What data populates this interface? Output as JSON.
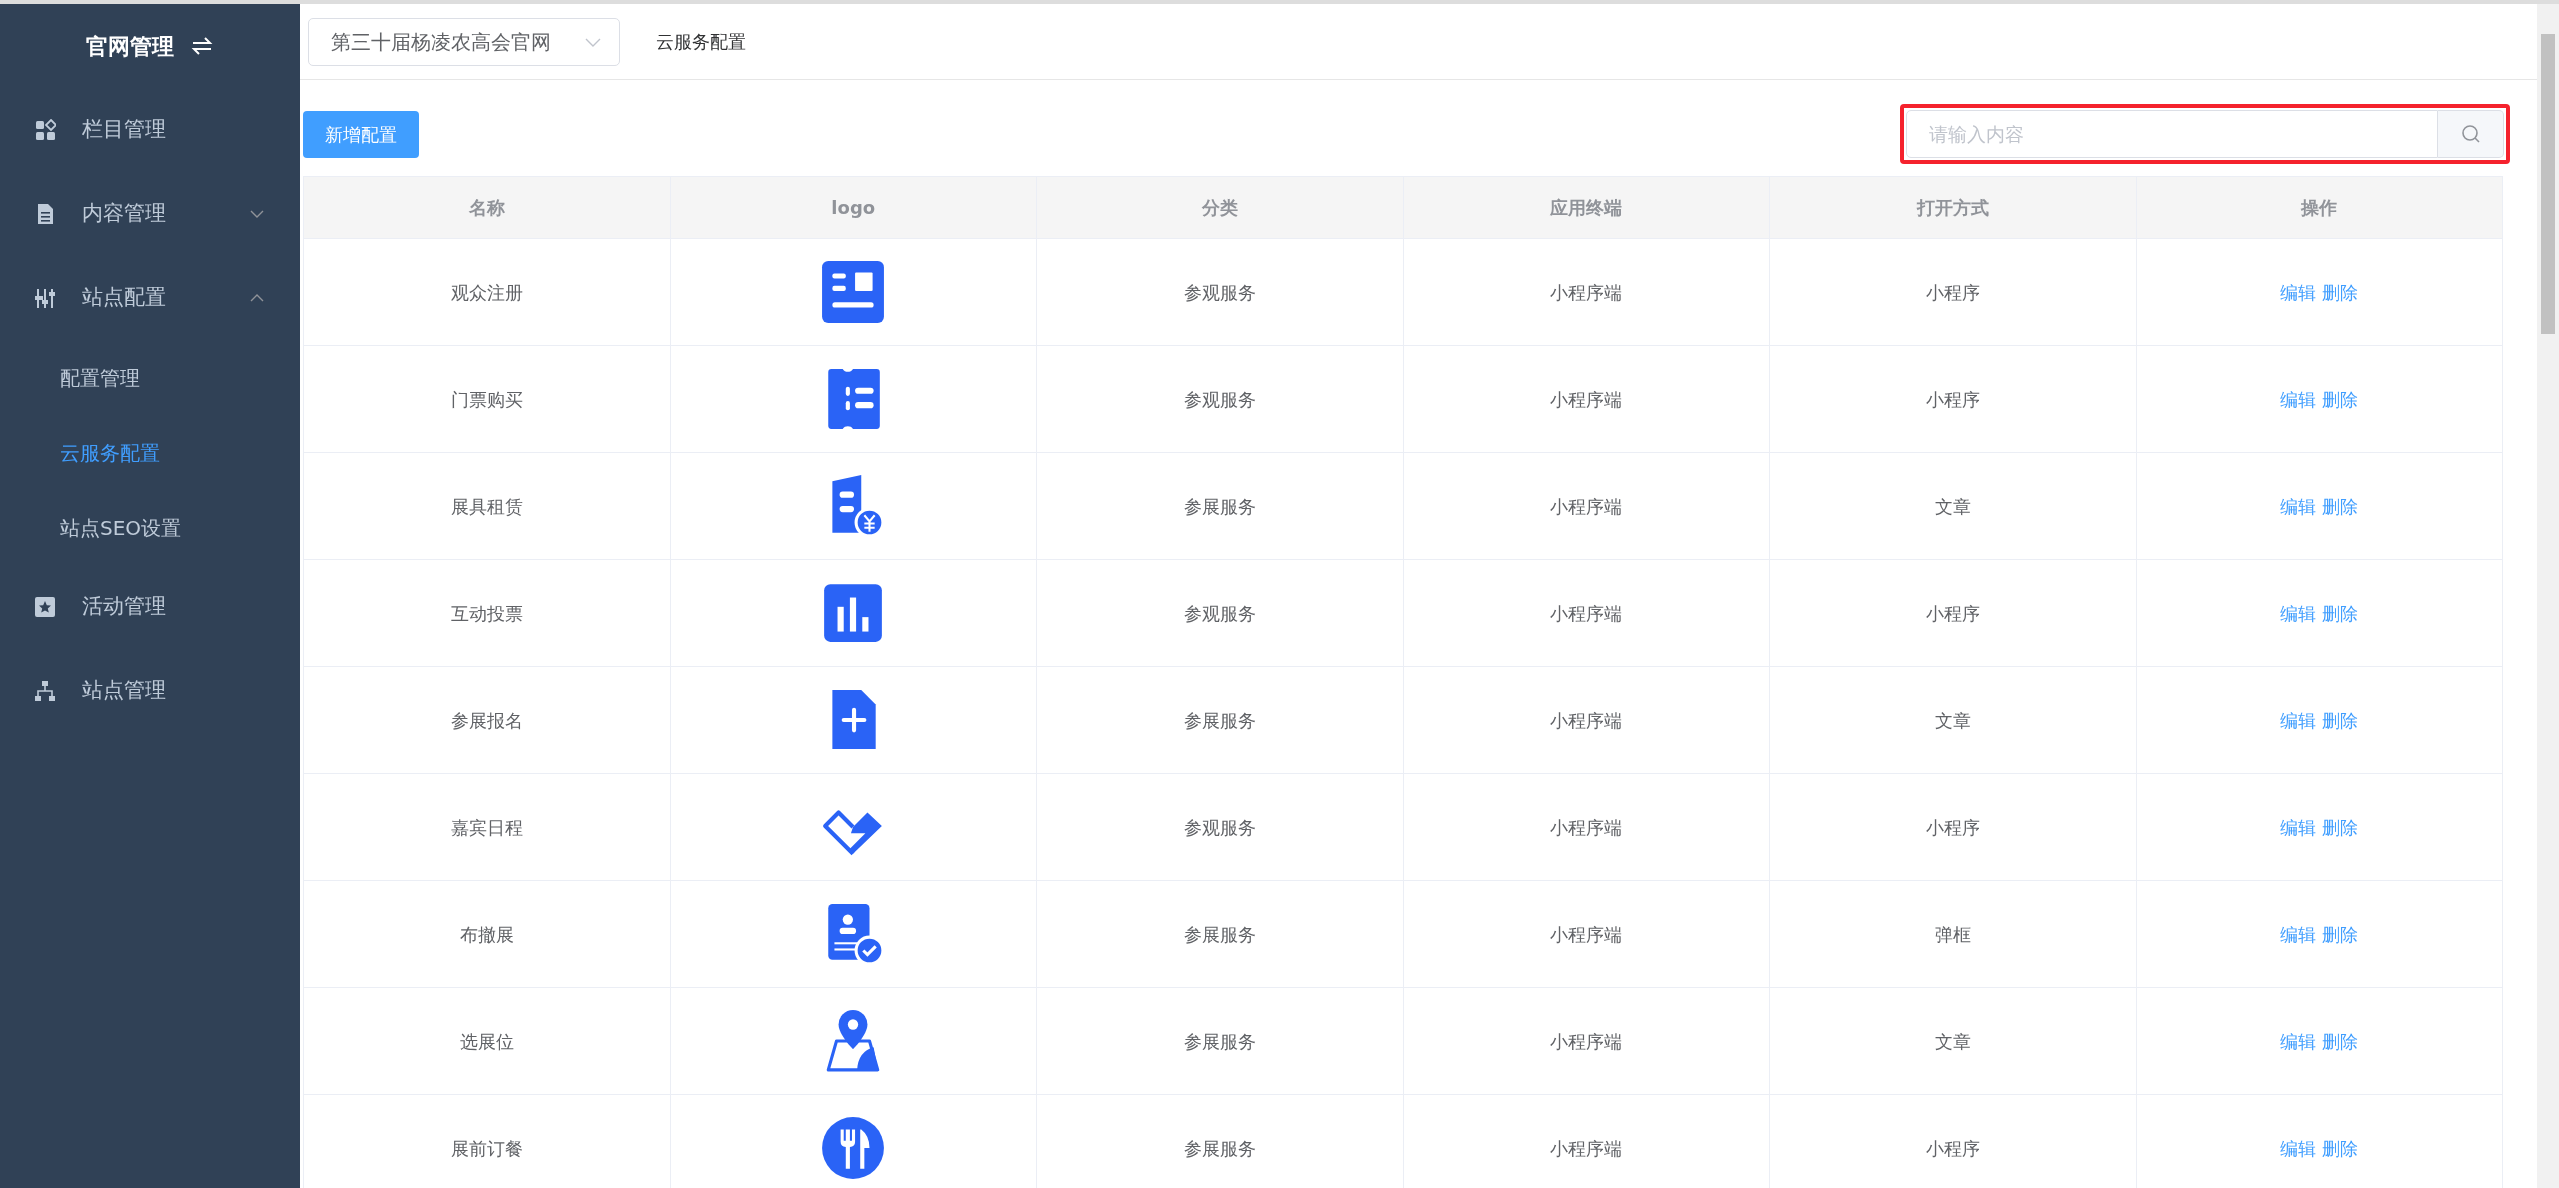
{
  "sidebar": {
    "title": "官网管理",
    "items": [
      {
        "kind": "grid",
        "label": "栏目管理"
      },
      {
        "kind": "document",
        "label": "内容管理",
        "expanded": false
      },
      {
        "kind": "sliders",
        "label": "站点配置",
        "expanded": true,
        "children": [
          {
            "label": "配置管理",
            "selected": false
          },
          {
            "label": "云服务配置",
            "selected": true
          },
          {
            "label": "站点SEO设置",
            "selected": false
          }
        ]
      },
      {
        "kind": "star",
        "label": "活动管理"
      },
      {
        "kind": "sitemap",
        "label": "站点管理"
      }
    ]
  },
  "header": {
    "site_select": {
      "value": "第三十届杨凌农高会官网"
    },
    "breadcrumb": "云服务配置"
  },
  "toolbar": {
    "add_button": "新增配置",
    "search": {
      "placeholder": "请输入内容"
    }
  },
  "table": {
    "columns": [
      "名称",
      "logo",
      "分类",
      "应用终端",
      "打开方式",
      "操作"
    ],
    "rows": [
      {
        "name": "观众注册",
        "kind": "news",
        "category": "参观服务",
        "terminal": "小程序端",
        "open_mode": "小程序",
        "actions": [
          "编辑",
          "删除"
        ]
      },
      {
        "name": "门票购买",
        "kind": "ticket",
        "category": "参观服务",
        "terminal": "小程序端",
        "open_mode": "小程序",
        "actions": [
          "编辑",
          "删除"
        ]
      },
      {
        "name": "展具租赁",
        "kind": "document-yen",
        "category": "参展服务",
        "terminal": "小程序端",
        "open_mode": "文章",
        "actions": [
          "编辑",
          "删除"
        ]
      },
      {
        "name": "互动投票",
        "kind": "bar-chart",
        "category": "参观服务",
        "terminal": "小程序端",
        "open_mode": "小程序",
        "actions": [
          "编辑",
          "删除"
        ]
      },
      {
        "name": "参展报名",
        "kind": "file-plus",
        "category": "参展服务",
        "terminal": "小程序端",
        "open_mode": "文章",
        "actions": [
          "编辑",
          "删除"
        ]
      },
      {
        "name": "嘉宾日程",
        "kind": "handshake",
        "category": "参观服务",
        "terminal": "小程序端",
        "open_mode": "小程序",
        "actions": [
          "编辑",
          "删除"
        ]
      },
      {
        "name": "布撤展",
        "kind": "id-check",
        "category": "参展服务",
        "terminal": "小程序端",
        "open_mode": "弹框",
        "actions": [
          "编辑",
          "删除"
        ]
      },
      {
        "name": "选展位",
        "kind": "map-pin",
        "category": "参展服务",
        "terminal": "小程序端",
        "open_mode": "文章",
        "actions": [
          "编辑",
          "删除"
        ]
      },
      {
        "name": "展前订餐",
        "kind": "fork-knife",
        "category": "参展服务",
        "terminal": "小程序端",
        "open_mode": "小程序",
        "actions": [
          "编辑",
          "删除"
        ]
      }
    ]
  }
}
